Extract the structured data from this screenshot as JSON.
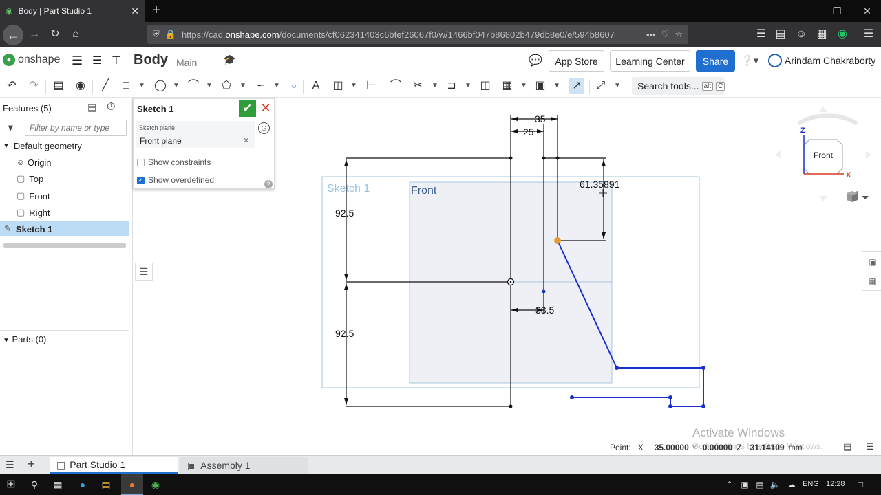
{
  "browser": {
    "tab_title": "Body | Part Studio 1",
    "url_prefix": "https://cad.",
    "url_domain": "onshape.com",
    "url_rest": "/documents/cf062341403c6bfef26067f0/w/1466bf047b86802b479db8e0/e/594b8607",
    "url_more": "•••"
  },
  "header": {
    "logo_text": "onshape",
    "doc_title": "Body",
    "branch": "Main",
    "app_store": "App Store",
    "learning_center": "Learning Center",
    "share": "Share",
    "user_name": "Arindam Chakraborty"
  },
  "toolbar": {
    "search_label": "Search tools...",
    "search_kbd1": "alt",
    "search_kbd2": "C"
  },
  "left_panel": {
    "features_title": "Features (5)",
    "filter_placeholder": "Filter by name or type",
    "default_geometry": "Default geometry",
    "items": [
      {
        "label": "Origin"
      },
      {
        "label": "Top"
      },
      {
        "label": "Front"
      },
      {
        "label": "Right"
      },
      {
        "label": "Sketch 1"
      }
    ],
    "parts_title": "Parts (0)"
  },
  "sketch_dialog": {
    "title": "Sketch 1",
    "plane_label": "Sketch plane",
    "plane_value": "Front plane",
    "show_constraints": "Show constraints",
    "show_overdefined": "Show overdefined",
    "show_constraints_checked": false,
    "show_overdefined_checked": true
  },
  "canvas": {
    "sketch_label": "Sketch 1",
    "plane_label": "Front",
    "dims": {
      "d35": "35",
      "d25": "25",
      "d61": "61.35891",
      "d92a": "92.5",
      "d92b": "92.5",
      "d33": "33.5"
    },
    "colors": {
      "sketch_line": "#1a2fd0",
      "plane_fill": "#eef0f6",
      "plane_border": "#a9c4de",
      "endpoint": "#e59a3b"
    }
  },
  "viewcube": {
    "face": "Front",
    "z": "Z",
    "x": "X"
  },
  "status": {
    "point_label": "Point:",
    "x_label": "X",
    "x_value": "35.00000",
    "y_label": "Y",
    "y_value": "0.00000",
    "z_label": "Z",
    "z_value": "31.14109",
    "unit": "mm"
  },
  "watermark": {
    "title": "Activate Windows",
    "sub": "Go to Settings to activate Windows."
  },
  "bottom_tabs": {
    "part_studio": "Part Studio 1",
    "assembly": "Assembly 1"
  },
  "taskbar": {
    "lang": "ENG",
    "time": "12:28"
  }
}
